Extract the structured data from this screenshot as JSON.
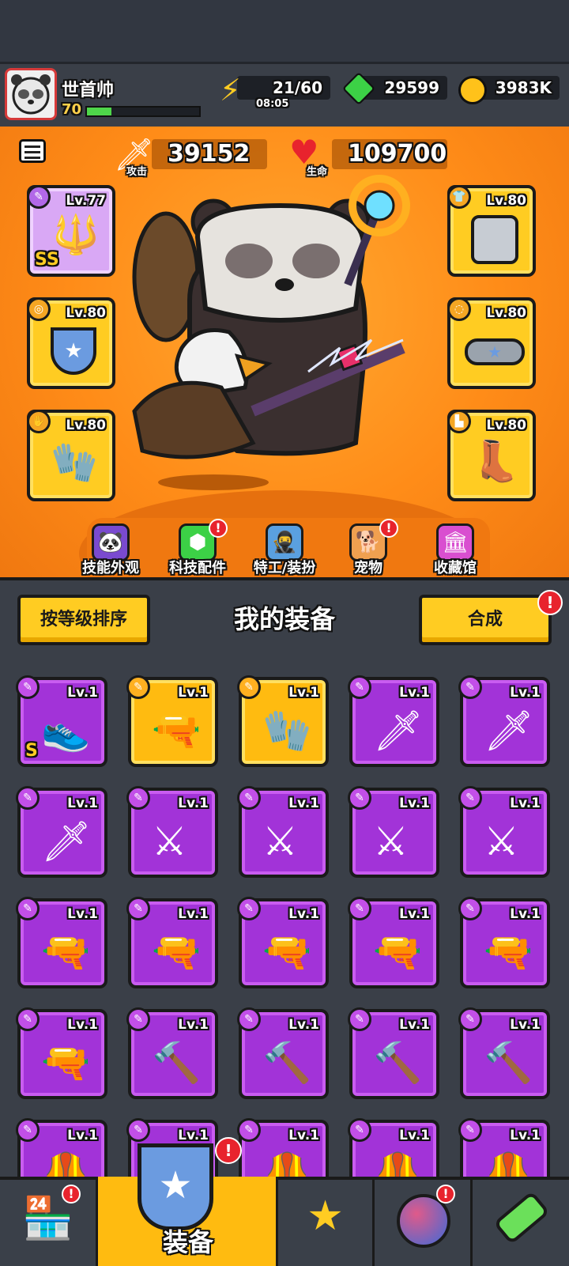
{
  "player": {
    "name": "世首帅",
    "level": "70",
    "xp_fraction": 0.22
  },
  "resources": {
    "energy": "21/60",
    "energy_timer": "08:05",
    "gems": "29599",
    "coins": "3983K"
  },
  "stats": {
    "attack_value": "39152",
    "attack_label": "攻击",
    "hp_value": "109700",
    "hp_label": "生命"
  },
  "equipped": {
    "weapon_level": "Lv.77",
    "weapon_rank": "SS",
    "armor_level": "Lv.80",
    "necklace_level": "Lv.80",
    "belt_level": "Lv.80",
    "gloves_level": "Lv.80",
    "boots_level": "Lv.80"
  },
  "menu": [
    {
      "label": "技能外观",
      "icon": "skill-skin-icon",
      "badge": false
    },
    {
      "label": "科技配件",
      "icon": "tech-part-icon",
      "badge": true
    },
    {
      "label": "特工/装扮",
      "icon": "agent-outfit-icon",
      "badge": false
    },
    {
      "label": "宠物",
      "icon": "pet-icon",
      "badge": true
    },
    {
      "label": "收藏馆",
      "icon": "collection-icon",
      "badge": false
    }
  ],
  "list": {
    "sort_label": "按等级排序",
    "title": "我的装备",
    "merge_label": "合成",
    "badge_mark": "!"
  },
  "items": [
    {
      "level": "Lv.1",
      "icon": "boots-icon",
      "rank": "S",
      "gold": false
    },
    {
      "level": "Lv.1",
      "icon": "revolver-icon",
      "gold": true
    },
    {
      "level": "Lv.1",
      "icon": "gauntlet-icon",
      "gold": true
    },
    {
      "level": "Lv.1",
      "icon": "kunai-icon",
      "gold": false
    },
    {
      "level": "Lv.1",
      "icon": "kunai-icon",
      "gold": false
    },
    {
      "level": "Lv.1",
      "icon": "kunai-icon",
      "gold": false
    },
    {
      "level": "Lv.1",
      "icon": "katana-icon",
      "gold": false
    },
    {
      "level": "Lv.1",
      "icon": "katana-icon",
      "gold": false
    },
    {
      "level": "Lv.1",
      "icon": "katana-icon",
      "gold": false
    },
    {
      "level": "Lv.1",
      "icon": "katana-icon",
      "gold": false
    },
    {
      "level": "Lv.1",
      "icon": "revolver-icon",
      "gold": false
    },
    {
      "level": "Lv.1",
      "icon": "revolver-icon",
      "gold": false
    },
    {
      "level": "Lv.1",
      "icon": "revolver-icon",
      "gold": false
    },
    {
      "level": "Lv.1",
      "icon": "shotgun-icon",
      "gold": false
    },
    {
      "level": "Lv.1",
      "icon": "shotgun-icon",
      "gold": false
    },
    {
      "level": "Lv.1",
      "icon": "shotgun-icon",
      "gold": false
    },
    {
      "level": "Lv.1",
      "icon": "drill-icon",
      "gold": false
    },
    {
      "level": "Lv.1",
      "icon": "drill-icon",
      "gold": false
    },
    {
      "level": "Lv.1",
      "icon": "drill-icon",
      "gold": false
    },
    {
      "level": "Lv.1",
      "icon": "drill-icon",
      "gold": false
    },
    {
      "level": "Lv.1",
      "icon": "armor-icon",
      "gold": false
    },
    {
      "level": "Lv.1",
      "icon": "armor-icon",
      "gold": false
    },
    {
      "level": "Lv.1",
      "icon": "armor-icon",
      "gold": false
    },
    {
      "level": "Lv.1",
      "icon": "armor-icon",
      "gold": false
    },
    {
      "level": "Lv.1",
      "icon": "armor-icon",
      "gold": false
    }
  ],
  "nav": {
    "equip_label": "装备",
    "items": [
      "shop-icon",
      "equipment-icon",
      "battle-star-icon",
      "planet-icon",
      "dna-icon"
    ]
  },
  "colors": {
    "purple": "#a233d8",
    "gold": "#ffcc22",
    "orange": "#ff8c18",
    "alert": "#e8232d"
  }
}
